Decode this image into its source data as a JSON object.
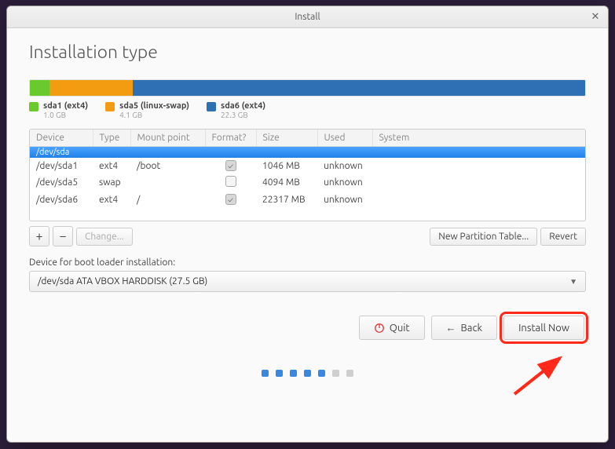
{
  "window": {
    "title": "Install"
  },
  "page_title": "Installation type",
  "disk_segments": [
    {
      "label": "sda1 (ext4)",
      "size": "1.0 GB",
      "color": "#6ac92d",
      "pct": 3.6
    },
    {
      "label": "sda5 (linux-swap)",
      "size": "4.1 GB",
      "color": "#f39c12",
      "pct": 14.9
    },
    {
      "label": "sda6 (ext4)",
      "size": "22.3 GB",
      "color": "#2f6fb3",
      "pct": 81.5
    }
  ],
  "columns": {
    "device": "Device",
    "type": "Type",
    "mount": "Mount point",
    "format": "Format?",
    "size": "Size",
    "used": "Used",
    "system": "System"
  },
  "disk_header": "/dev/sda",
  "rows": [
    {
      "device": "/dev/sda1",
      "type": "ext4",
      "mount": "/boot",
      "format": true,
      "size": "1046 MB",
      "used": "unknown",
      "system": ""
    },
    {
      "device": "/dev/sda5",
      "type": "swap",
      "mount": "",
      "format": false,
      "size": "4094 MB",
      "used": "unknown",
      "system": ""
    },
    {
      "device": "/dev/sda6",
      "type": "ext4",
      "mount": "/",
      "format": true,
      "size": "22317 MB",
      "used": "unknown",
      "system": ""
    }
  ],
  "toolbar": {
    "add": "+",
    "remove": "−",
    "change": "Change...",
    "new_table": "New Partition Table...",
    "revert": "Revert"
  },
  "bootloader_label": "Device for boot loader installation:",
  "bootloader_value": "/dev/sda   ATA VBOX HARDDISK (27.5 GB)",
  "nav": {
    "quit": "Quit",
    "back": "Back",
    "install": "Install Now"
  },
  "progress_dots": {
    "total": 7,
    "active": 5
  }
}
